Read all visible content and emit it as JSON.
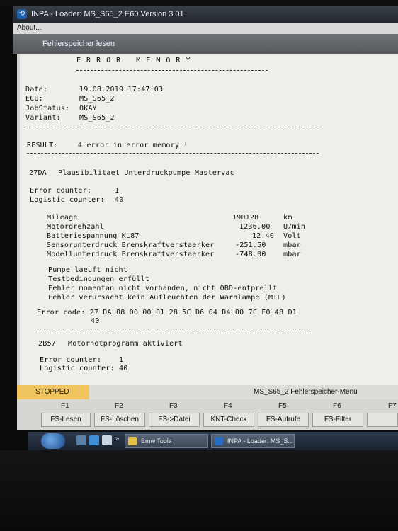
{
  "window": {
    "title": "INPA - Loader: MS_S65_2 E60 Version 3.01",
    "menu_about": "About...",
    "subheader": "Fehlerspeicher lesen"
  },
  "report": {
    "heading": "E R R O R   M E M O R Y",
    "date_label": "Date:",
    "date_value": "19.08.2019 17:47:03",
    "ecu_label": "ECU:",
    "ecu_value": "MS_S65_2",
    "jobstatus_label": "JobStatus:",
    "jobstatus_value": "OKAY",
    "variant_label": "Variant:",
    "variant_value": "MS_S65_2",
    "result_label": "RESULT:",
    "result_value": "4 error in error memory !",
    "error1": {
      "code": "27DA",
      "text": "Plausibilitaet Unterdruckpumpe Mastervac",
      "counter_label": "Error counter:",
      "counter_value": "1",
      "logistic_label": "Logistic counter:",
      "logistic_value": "40",
      "env": [
        {
          "name": "Mileage",
          "value": "190128",
          "unit": "km"
        },
        {
          "name": "Motordrehzahl",
          "value": "1236.00",
          "unit": "U/min"
        },
        {
          "name": "Batteriespannung KL87",
          "value": "12.40",
          "unit": "Volt"
        },
        {
          "name": "Sensorunterdruck Bremskraftverstaerker",
          "value": "-251.50",
          "unit": "mbar"
        },
        {
          "name": "Modellunterdruck Bremskraftverstaerker",
          "value": "-748.00",
          "unit": "mbar"
        }
      ],
      "notes": [
        "Pumpe laeuft nicht",
        "Testbedingungen erfüllt",
        "Fehler momentan nicht vorhanden, nicht OBD-entprellt",
        "Fehler verursacht kein Aufleuchten der Warnlampe (MIL)"
      ],
      "errcode_line1": "Error code: 27 DA 08 00 00 01 28 5C D6 04 D4 00 7C F0 48 D1",
      "errcode_line2": "40"
    },
    "error2": {
      "code": "2B57",
      "text": "Motornotprogramm aktiviert",
      "counter_label": "Error counter:",
      "counter_value": "1",
      "logistic_label": "Logistic counter:",
      "logistic_value": "40"
    }
  },
  "status": {
    "state": "STOPPED",
    "menu_title": "MS_S65_2 Fehlerspeicher-Menü"
  },
  "fkeys": [
    {
      "key": "F1",
      "label": "FS-Lesen"
    },
    {
      "key": "F2",
      "label": "FS-Löschen"
    },
    {
      "key": "F3",
      "label": "FS->Datei"
    },
    {
      "key": "F4",
      "label": "KNT-Check"
    },
    {
      "key": "F5",
      "label": "FS-Aufrufe"
    },
    {
      "key": "F6",
      "label": "FS-Filter"
    },
    {
      "key": "F7",
      "label": ""
    }
  ],
  "taskbar": {
    "task1": "Bmw Tools",
    "task2": "INPA - Loader: MS_S...",
    "overflow": "»"
  },
  "colors": {
    "stopped_bg": "#f0c560",
    "content_bg": "#eeeeea",
    "titlebar_bg": "#2b3137"
  }
}
